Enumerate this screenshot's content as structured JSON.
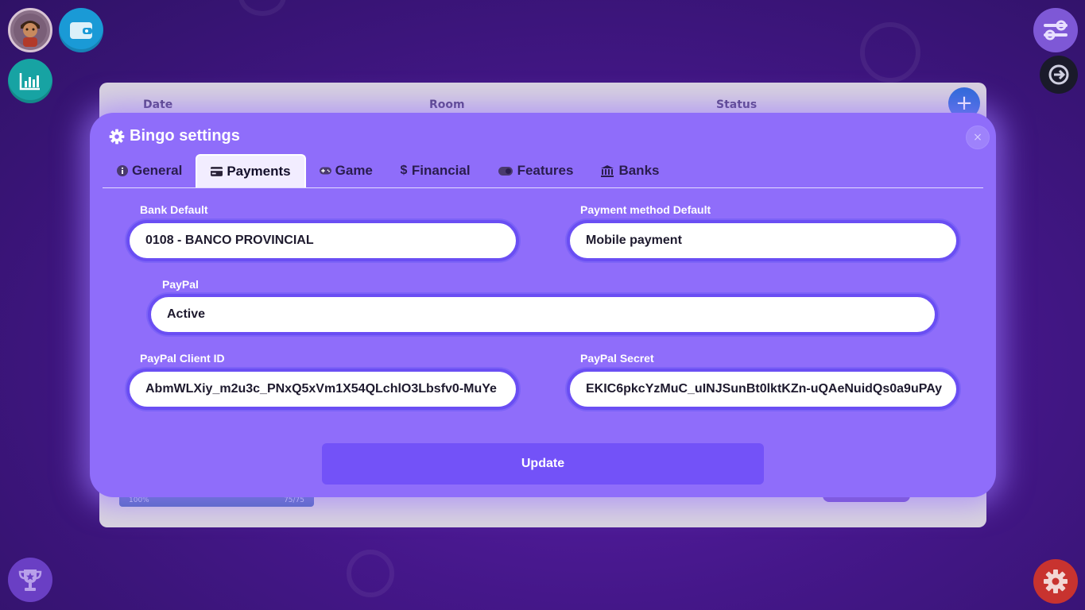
{
  "background": {
    "columns": [
      "Date",
      "Room",
      "Status"
    ],
    "progress_left": "100%",
    "progress_right": "75/75"
  },
  "modal": {
    "title": "Bingo settings",
    "close_label": "×"
  },
  "tabs": [
    {
      "label": "General",
      "icon": "info-icon"
    },
    {
      "label": "Payments",
      "icon": "credit-card-icon",
      "active": true
    },
    {
      "label": "Game",
      "icon": "gamepad-icon"
    },
    {
      "label": "Financial",
      "icon": "dollar-icon"
    },
    {
      "label": "Features",
      "icon": "toggle-icon"
    },
    {
      "label": "Banks",
      "icon": "bank-icon"
    }
  ],
  "form": {
    "bank_default": {
      "label": "Bank Default",
      "value": "0108 - BANCO PROVINCIAL"
    },
    "payment_method_default": {
      "label": "Payment method Default",
      "value": "Mobile payment"
    },
    "paypal": {
      "label": "PayPal",
      "value": "Active"
    },
    "paypal_client_id": {
      "label": "PayPal Client ID",
      "value": "AbmWLXiy_m2u3c_PNxQ5xVm1X54QLchlO3Lbsfv0-MuYe"
    },
    "paypal_secret": {
      "label": "PayPal Secret",
      "value": "EKIC6pkcYzMuC_uINJSunBt0lktKZn-uQAeNuidQs0a9uPAy"
    },
    "update_label": "Update"
  },
  "colors": {
    "modal": "#8f6dfa",
    "field_border": "#6a4ef3",
    "update_button": "#7352f8",
    "gear_fab": "#c8332f"
  }
}
